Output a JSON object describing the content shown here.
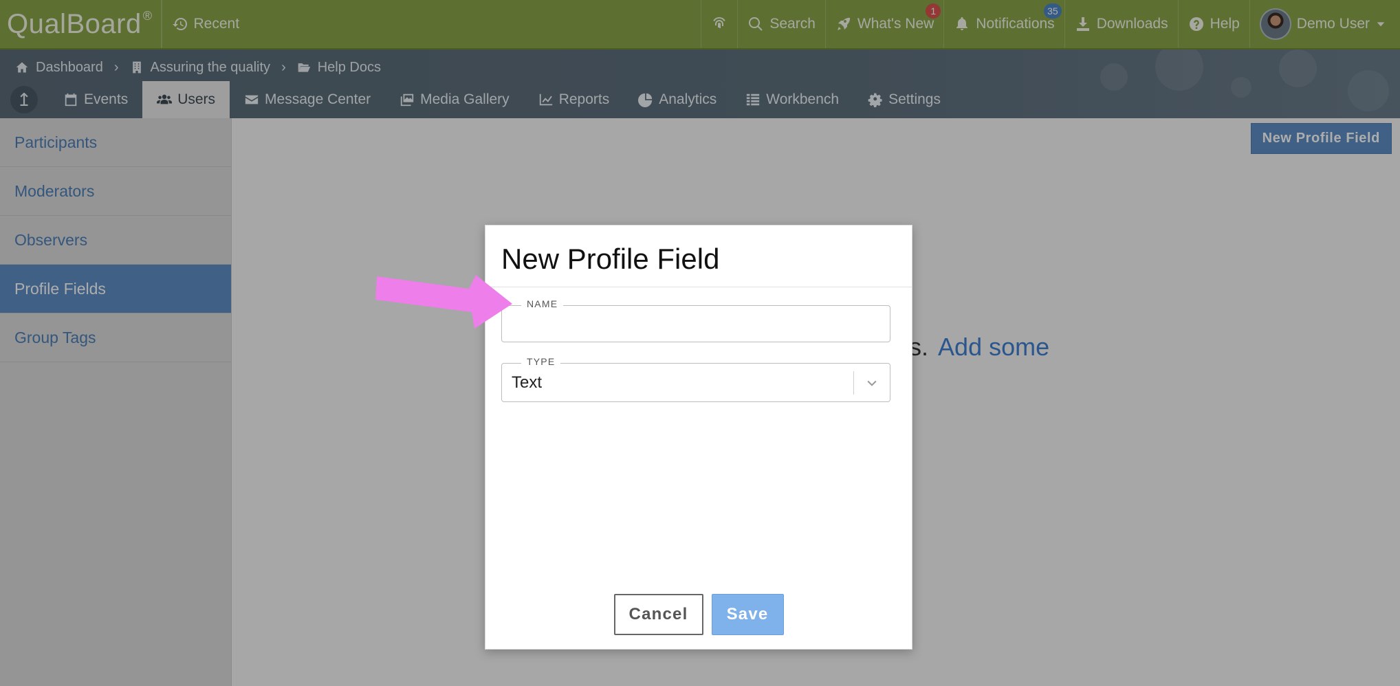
{
  "app": {
    "logo": "QualBoard",
    "logo_mark": "®"
  },
  "topbar": {
    "recent": "Recent",
    "search": "Search",
    "whats_new": "What's New",
    "whats_new_badge": "1",
    "notifications": "Notifications",
    "notifications_badge": "35",
    "downloads": "Downloads",
    "help": "Help",
    "user": "Demo User"
  },
  "breadcrumb": {
    "items": [
      "Dashboard",
      "Assuring the quality",
      "Help Docs"
    ]
  },
  "tabs": {
    "items": [
      "Events",
      "Users",
      "Message Center",
      "Media Gallery",
      "Reports",
      "Analytics",
      "Workbench",
      "Settings"
    ],
    "active": "Users"
  },
  "sidebar": {
    "items": [
      "Participants",
      "Moderators",
      "Observers",
      "Profile Fields",
      "Group Tags"
    ],
    "active": "Profile Fields"
  },
  "main": {
    "new_button": "New Profile Field",
    "empty_prefix": "s.",
    "empty_link": "Add some"
  },
  "modal": {
    "title": "New Profile Field",
    "name_label": "NAME",
    "name_value": "",
    "type_label": "TYPE",
    "type_value": "Text",
    "cancel": "Cancel",
    "save": "Save"
  },
  "colors": {
    "topbar": "#8aa64a",
    "subheader": "#5f707d",
    "accent": "#5f8fc4",
    "save_button": "#7fb1ea",
    "arrow": "#ee7eea"
  }
}
